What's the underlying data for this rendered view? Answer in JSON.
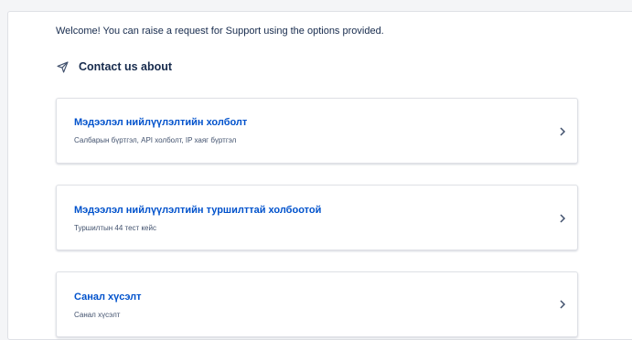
{
  "welcome_text": "Welcome! You can raise a request for Support using the options provided.",
  "section": {
    "title": "Contact us about",
    "icon": "send-icon"
  },
  "cards": [
    {
      "title": "Мэдээлэл нийлүүлэлтийн холболт",
      "subtitle": "Салбарын бүртгэл, API холболт, IP хаяг бүртгэл"
    },
    {
      "title": "Мэдээлэл нийлүүлэлтийн туршилттай холбоотой",
      "subtitle": "Туршилтын 44 тест кейс"
    },
    {
      "title": "Санал хүсэлт",
      "subtitle": "Санал хүсэлт"
    }
  ],
  "colors": {
    "link": "#0052cc",
    "text": "#172b4d",
    "muted": "#42526e",
    "border": "#dfe1e6"
  }
}
